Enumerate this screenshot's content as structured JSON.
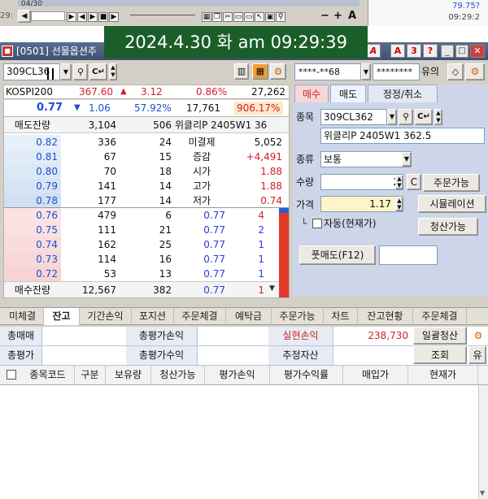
{
  "timestamp": "2024.4.30 화 am 09:29:39",
  "background_window": {
    "left_label": "04/30",
    "side_left": "29:",
    "right_values": [
      "79.75?",
      "09:29:2"
    ],
    "tool_glyphs": [
      "+",
      "A",
      "−"
    ]
  },
  "window": {
    "title": "[0501] 선물옵션주",
    "title_buttons": [
      "A",
      "3",
      "?"
    ]
  },
  "toolbar": {
    "code": "309CL36",
    "account_mask": "****-**68",
    "password_mask": "********",
    "yuui_label": "유의"
  },
  "quote": {
    "index_name": "KOSPI200",
    "index_value": "367.60",
    "index_change": "3.12",
    "index_rate": "0.86%",
    "volume": "27,262",
    "price": "0.77",
    "change": "1.06",
    "rate": "57.92%",
    "trade_qty": "17,761",
    "trade_rate": "906.17%",
    "ask_total_label": "매도잔량",
    "ask_total_qty": "3,104",
    "ask_total_cnt": "506",
    "instrument_name": "위클리P 2405W1 36",
    "asks": [
      {
        "price": "0.82",
        "qty": "336",
        "cnt": "24",
        "label": "미결제",
        "value": "5,052"
      },
      {
        "price": "0.81",
        "qty": "67",
        "cnt": "15",
        "label": "증감",
        "value": "+4,491"
      },
      {
        "price": "0.80",
        "qty": "70",
        "cnt": "18",
        "label": "시가",
        "value": "1.88"
      },
      {
        "price": "0.79",
        "qty": "141",
        "cnt": "14",
        "label": "고가",
        "value": "1.88"
      },
      {
        "price": "0.78",
        "qty": "177",
        "cnt": "14",
        "label": "저가",
        "value": "0.74"
      }
    ],
    "bids": [
      {
        "price": "0.76",
        "qty": "479",
        "cnt": "6",
        "tprice": "0.77",
        "tqty": "4"
      },
      {
        "price": "0.75",
        "qty": "111",
        "cnt": "21",
        "tprice": "0.77",
        "tqty": "2"
      },
      {
        "price": "0.74",
        "qty": "162",
        "cnt": "25",
        "tprice": "0.77",
        "tqty": "1"
      },
      {
        "price": "0.73",
        "qty": "114",
        "cnt": "16",
        "tprice": "0.77",
        "tqty": "1"
      },
      {
        "price": "0.72",
        "qty": "53",
        "cnt": "13",
        "tprice": "0.77",
        "tqty": "1"
      }
    ],
    "bid_total_label": "매수잔량",
    "bid_total_qty": "12,567",
    "bid_total_cnt": "382",
    "bid_total_tprice": "0.77",
    "bid_total_tqty": "1"
  },
  "order": {
    "tabs": [
      "매수",
      "매도",
      "정정/취소"
    ],
    "code_label": "종목",
    "code_value": "309CL362",
    "instrument": "위클리P 2405W1 362.5",
    "type_label": "종류",
    "type_value": "보통",
    "qty_label": "수량",
    "qty_value": "2",
    "c_button": "C",
    "order_avail_button": "주문가능",
    "price_label": "가격",
    "price_value": "1.17",
    "simulation_button": "시뮬레이션",
    "auto_label": "자동(현재가)",
    "liquidation_button": "청산가능",
    "submit_button": "풋매도(F12)"
  },
  "bottom_tabs": [
    "미체결",
    "잔고",
    "기간손익",
    "포지션",
    "주문체결",
    "예탁금",
    "주문가능",
    "차트",
    "잔고현황",
    "주문체결"
  ],
  "active_bottom_tab": 1,
  "summary": {
    "row1": {
      "total_sell": "총매매",
      "total_pnl": "총평가손익",
      "realized_label": "실현손익",
      "realized_value": "238,730",
      "bulk_label": "일괄청산"
    },
    "row2": {
      "total_eval": "총평가",
      "total_rate": "총평가수익",
      "est_asset": "추정자산",
      "inquiry": "조회",
      "yu": "유"
    }
  },
  "grid_headers": [
    "종목코드",
    "구분",
    "보유량",
    "청산가능",
    "평가손익",
    "평가수익률",
    "매입가",
    "현재가"
  ],
  "colors": {
    "accent_red": "#d21f2a",
    "accent_blue": "#1a4fd1",
    "timestamp_bg": "#1b5e2a",
    "order_panel_bg": "#cdd6e9"
  }
}
